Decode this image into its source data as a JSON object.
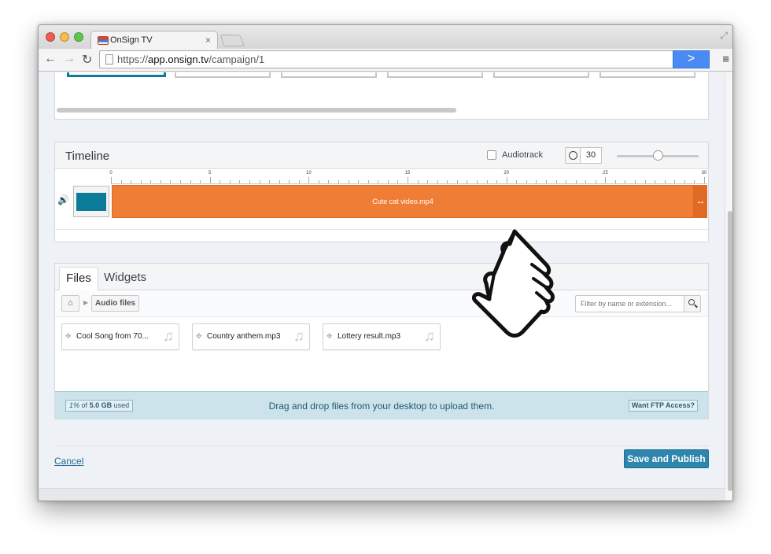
{
  "browser": {
    "tab_title": "OnSign TV",
    "tab_close": "×",
    "url_scheme": "https://",
    "url_host": "app.onsign.tv",
    "url_path": "/campaign/1",
    "go_glyph": ">",
    "menu_glyph": "≡",
    "back_glyph": "←",
    "forward_glyph": "→",
    "reload_glyph": "↻",
    "fullscreen_glyph": "⤢",
    "traffic_colors": [
      "#ee5c54",
      "#f5be4f",
      "#5ec84e"
    ]
  },
  "timeline": {
    "title": "Timeline",
    "audiotrack_label": "Audiotrack",
    "audiotrack_checked": false,
    "duration": "30",
    "zoom_level": 0.5,
    "ruler_labels": [
      "0",
      "5",
      "10",
      "15",
      "20",
      "25",
      "30"
    ],
    "clip_name": "Cute cat video.mp4",
    "clip_color": "#f07d35",
    "speaker_glyph": "🔊",
    "resize_glyph": "↔"
  },
  "files": {
    "tab_files": "Files",
    "tab_widgets": "Widgets",
    "home_glyph": "⌂",
    "breadcrumb": "Audio files",
    "filter_placeholder": "Filter by name or extension...",
    "items": [
      {
        "name": "Cool Song from 70...",
        "icon": "music-note-icon"
      },
      {
        "name": "Country anthem.mp3",
        "icon": "music-note-icon"
      },
      {
        "name": "Lottery result.mp3",
        "icon": "music-note-icon"
      }
    ],
    "move_glyph": "✥",
    "note_glyph": "♫",
    "quota_used": "1%",
    "quota_of": "of",
    "quota_total": "5.0 GB",
    "quota_suffix": "used",
    "drop_message": "Drag and drop files from your desktop to upload them.",
    "ftp_label": "Want FTP Access?"
  },
  "footer": {
    "cancel_label": "Cancel",
    "publish_label": "Save and Publish"
  },
  "colors": {
    "accent": "#2e86ad",
    "clip": "#f07d35",
    "upload_bg": "#cde3eb"
  }
}
